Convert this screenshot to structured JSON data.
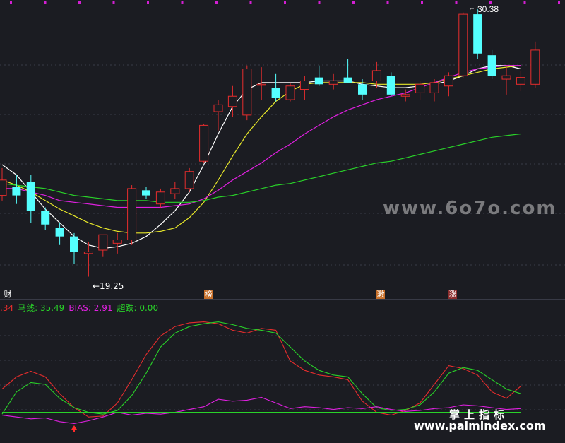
{
  "chart_data": [
    {
      "type": "candlestick",
      "annotations": {
        "high_label": "30.38",
        "low_label": "←19.25",
        "high_marker": "←"
      },
      "event_tags": [
        "财",
        "榜",
        "激",
        "涨"
      ],
      "moving_averages": [
        {
          "color": "#ffffff",
          "values": [
            25.8,
            25.2,
            24.2,
            23.2,
            22.4,
            21.6,
            21.1,
            20.9,
            21.0,
            21.2,
            21.6,
            22.3,
            23.1,
            24.2,
            25.8,
            27.6,
            29.2,
            30.2,
            30.6,
            30.6,
            30.6,
            30.6,
            30.7,
            30.7,
            30.7,
            30.5,
            30.4,
            30.3,
            30.3,
            30.4,
            30.5,
            30.7,
            31.0,
            31.4,
            31.6,
            31.6,
            31.4
          ]
        },
        {
          "color": "#e8e82a",
          "values": [
            24.9,
            24.6,
            24.2,
            23.7,
            23.2,
            22.8,
            22.4,
            22.1,
            21.9,
            21.8,
            21.8,
            21.9,
            22.1,
            22.7,
            23.6,
            24.9,
            26.3,
            27.6,
            28.6,
            29.5,
            30.1,
            30.5,
            30.6,
            30.6,
            30.6,
            30.6,
            30.5,
            30.5,
            30.5,
            30.5,
            30.6,
            30.8,
            31.0,
            31.2,
            31.4,
            31.5,
            31.6
          ]
        },
        {
          "color": "#e020e0",
          "values": [
            24.4,
            24.4,
            24.2,
            24.0,
            23.7,
            23.6,
            23.5,
            23.4,
            23.3,
            23.3,
            23.3,
            23.3,
            23.4,
            23.5,
            23.8,
            24.3,
            24.9,
            25.4,
            25.9,
            26.5,
            27.0,
            27.6,
            28.1,
            28.6,
            29.0,
            29.3,
            29.6,
            29.8,
            30.0,
            30.3,
            30.6,
            30.9,
            31.2,
            31.4,
            31.5,
            31.6,
            31.6
          ]
        },
        {
          "color": "#29d129",
          "values": [
            24.7,
            24.6,
            24.5,
            24.4,
            24.2,
            24.0,
            23.9,
            23.8,
            23.7,
            23.7,
            23.7,
            23.6,
            23.6,
            23.6,
            23.7,
            23.9,
            24.0,
            24.2,
            24.4,
            24.6,
            24.7,
            24.9,
            25.1,
            25.3,
            25.5,
            25.7,
            25.9,
            26.0,
            26.2,
            26.4,
            26.6,
            26.8,
            27.0,
            27.2,
            27.4,
            27.5,
            27.6
          ]
        }
      ],
      "candles": [
        {
          "o": 24.0,
          "h": 25.6,
          "l": 23.7,
          "c": 24.9
        },
        {
          "o": 24.5,
          "h": 25.2,
          "l": 23.5,
          "c": 24.0
        },
        {
          "o": 24.8,
          "h": 25.2,
          "l": 22.4,
          "c": 23.1
        },
        {
          "o": 23.1,
          "h": 23.3,
          "l": 22.0,
          "c": 22.3
        },
        {
          "o": 22.1,
          "h": 22.4,
          "l": 21.1,
          "c": 21.6
        },
        {
          "o": 21.6,
          "h": 21.8,
          "l": 20.0,
          "c": 20.7
        },
        {
          "o": 20.6,
          "h": 21.3,
          "l": 19.25,
          "c": 20.7
        },
        {
          "o": 20.8,
          "h": 21.7,
          "l": 20.4,
          "c": 21.7
        },
        {
          "o": 21.2,
          "h": 21.8,
          "l": 20.6,
          "c": 21.4
        },
        {
          "o": 21.4,
          "h": 24.6,
          "l": 21.1,
          "c": 24.4
        },
        {
          "o": 24.3,
          "h": 24.5,
          "l": 23.8,
          "c": 24.0
        },
        {
          "o": 23.5,
          "h": 24.4,
          "l": 23.3,
          "c": 24.2
        },
        {
          "o": 24.1,
          "h": 24.8,
          "l": 23.8,
          "c": 24.4
        },
        {
          "o": 24.4,
          "h": 25.6,
          "l": 24.2,
          "c": 25.4
        },
        {
          "o": 26.0,
          "h": 28.2,
          "l": 25.9,
          "c": 28.1
        },
        {
          "o": 28.9,
          "h": 29.6,
          "l": 27.8,
          "c": 29.3
        },
        {
          "o": 29.2,
          "h": 30.4,
          "l": 28.6,
          "c": 29.8
        },
        {
          "o": 28.7,
          "h": 31.6,
          "l": 28.4,
          "c": 31.4
        },
        {
          "o": 30.5,
          "h": 31.5,
          "l": 29.6,
          "c": 30.5
        },
        {
          "o": 30.3,
          "h": 31.1,
          "l": 29.5,
          "c": 29.7
        },
        {
          "o": 29.6,
          "h": 30.6,
          "l": 29.5,
          "c": 30.4
        },
        {
          "o": 30.2,
          "h": 31.0,
          "l": 29.6,
          "c": 30.7
        },
        {
          "o": 30.9,
          "h": 31.6,
          "l": 30.4,
          "c": 30.5
        },
        {
          "o": 30.5,
          "h": 31.1,
          "l": 30.2,
          "c": 30.7
        },
        {
          "o": 30.9,
          "h": 32.0,
          "l": 30.6,
          "c": 30.6
        },
        {
          "o": 30.5,
          "h": 30.8,
          "l": 29.6,
          "c": 29.9
        },
        {
          "o": 30.7,
          "h": 31.8,
          "l": 30.3,
          "c": 31.3
        },
        {
          "o": 31.0,
          "h": 31.2,
          "l": 29.8,
          "c": 29.9
        },
        {
          "o": 29.8,
          "h": 30.2,
          "l": 29.5,
          "c": 29.9
        },
        {
          "o": 30.0,
          "h": 30.7,
          "l": 29.6,
          "c": 30.5
        },
        {
          "o": 30.0,
          "h": 30.8,
          "l": 29.5,
          "c": 30.6
        },
        {
          "o": 30.4,
          "h": 31.2,
          "l": 29.8,
          "c": 31.0
        },
        {
          "o": 31.0,
          "h": 34.7,
          "l": 30.9,
          "c": 34.6
        },
        {
          "o": 34.6,
          "h": 34.9,
          "l": 32.0,
          "c": 32.3
        },
        {
          "o": 32.2,
          "h": 32.5,
          "l": 30.8,
          "c": 31.0
        },
        {
          "o": 30.8,
          "h": 31.6,
          "l": 29.9,
          "c": 31.0
        },
        {
          "o": 30.5,
          "h": 31.3,
          "l": 30.1,
          "c": 30.9
        },
        {
          "o": 30.5,
          "h": 33.0,
          "l": 30.3,
          "c": 32.5
        }
      ]
    },
    {
      "type": "line",
      "legend": [
        {
          "text": ".34",
          "color": "#e62d2d"
        },
        {
          "text": "马线: 35.49",
          "color": "#29d129"
        },
        {
          "text": "BIAS: 2.91",
          "color": "#e020e0"
        },
        {
          "text": "超跌: 0.00",
          "color": "#29d129"
        }
      ],
      "series": [
        {
          "color": "#e62d2d",
          "values": [
            25,
            38,
            44,
            38,
            20,
            5,
            -5,
            -4,
            10,
            35,
            62,
            82,
            92,
            96,
            97,
            95,
            88,
            85,
            90,
            88,
            55,
            45,
            40,
            38,
            35,
            12,
            0,
            -3,
            2,
            10,
            30,
            50,
            47,
            40,
            22,
            15,
            28
          ]
        },
        {
          "color": "#29d129",
          "values": [
            -2,
            22,
            32,
            30,
            15,
            5,
            0,
            -2,
            2,
            18,
            42,
            70,
            85,
            92,
            95,
            97,
            94,
            90,
            88,
            85,
            70,
            55,
            45,
            40,
            38,
            20,
            5,
            2,
            3,
            8,
            22,
            42,
            48,
            45,
            35,
            25,
            20
          ]
        },
        {
          "color": "#e020e0",
          "values": [
            -3,
            -5,
            -7,
            -6,
            -10,
            -12,
            -9,
            -5,
            0,
            -3,
            -1,
            -2,
            0,
            3,
            6,
            14,
            12,
            13,
            16,
            10,
            4,
            6,
            5,
            3,
            5,
            4,
            6,
            3,
            1,
            2,
            4,
            5,
            8,
            7,
            5,
            3,
            4
          ]
        },
        {
          "color": "#29d129",
          "values": [
            0,
            0,
            0,
            0,
            0,
            0,
            0,
            0,
            0,
            0,
            0,
            0,
            0,
            0,
            0,
            0,
            0,
            0,
            0,
            0,
            0,
            0,
            0,
            0,
            0,
            0,
            0,
            0,
            0,
            0,
            0,
            0,
            0,
            0,
            0,
            0,
            0
          ]
        }
      ],
      "signal_arrow_index": 5
    }
  ],
  "watermark": "www.6o7o.com",
  "brand": {
    "cn": "掌上指标",
    "url": "www.palmindex.com"
  }
}
